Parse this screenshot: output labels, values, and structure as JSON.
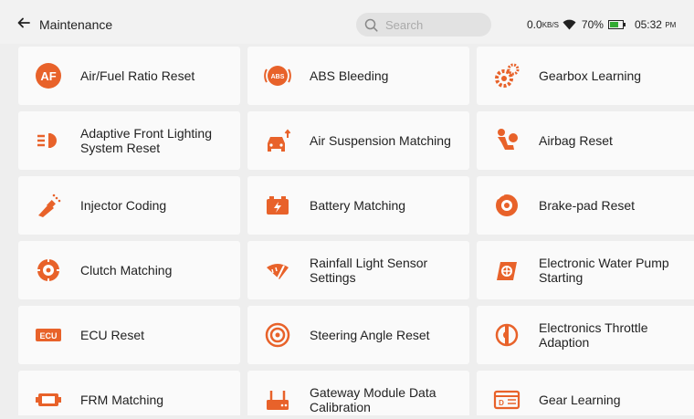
{
  "header": {
    "title": "Maintenance",
    "search_placeholder": "Search"
  },
  "status": {
    "net_speed": "0.0",
    "net_unit": "KB/S",
    "battery_percent": "70%",
    "time": "05:32",
    "ampm": "PM"
  },
  "colors": {
    "accent": "#e8622a"
  },
  "items": [
    {
      "label": "Air/Fuel Ratio Reset",
      "icon": "af-icon",
      "icon_text": "AF"
    },
    {
      "label": "ABS Bleeding",
      "icon": "abs-icon",
      "icon_text": "ABS"
    },
    {
      "label": "Gearbox Learning",
      "icon": "gears-icon"
    },
    {
      "label": "Adaptive Front Lighting System Reset",
      "icon": "headlight-icon"
    },
    {
      "label": "Air Suspension Matching",
      "icon": "car-suspension-icon"
    },
    {
      "label": "Airbag Reset",
      "icon": "airbag-icon"
    },
    {
      "label": "Injector Coding",
      "icon": "injector-icon"
    },
    {
      "label": "Battery Matching",
      "icon": "battery-icon"
    },
    {
      "label": "Brake-pad Reset",
      "icon": "brake-disc-icon"
    },
    {
      "label": "Clutch Matching",
      "icon": "clutch-icon"
    },
    {
      "label": "Rainfall Light Sensor Settings",
      "icon": "wiper-icon"
    },
    {
      "label": "Electronic Water Pump Starting",
      "icon": "water-pump-icon"
    },
    {
      "label": "ECU Reset",
      "icon": "ecu-icon",
      "icon_text": "ECU"
    },
    {
      "label": "Steering Angle Reset",
      "icon": "steering-icon"
    },
    {
      "label": "Electronics Throttle Adaption",
      "icon": "throttle-icon"
    },
    {
      "label": "FRM Matching",
      "icon": "frm-module-icon"
    },
    {
      "label": "Gateway Module Data Calibration",
      "icon": "gateway-icon"
    },
    {
      "label": "Gear Learning",
      "icon": "gear-display-icon"
    }
  ]
}
